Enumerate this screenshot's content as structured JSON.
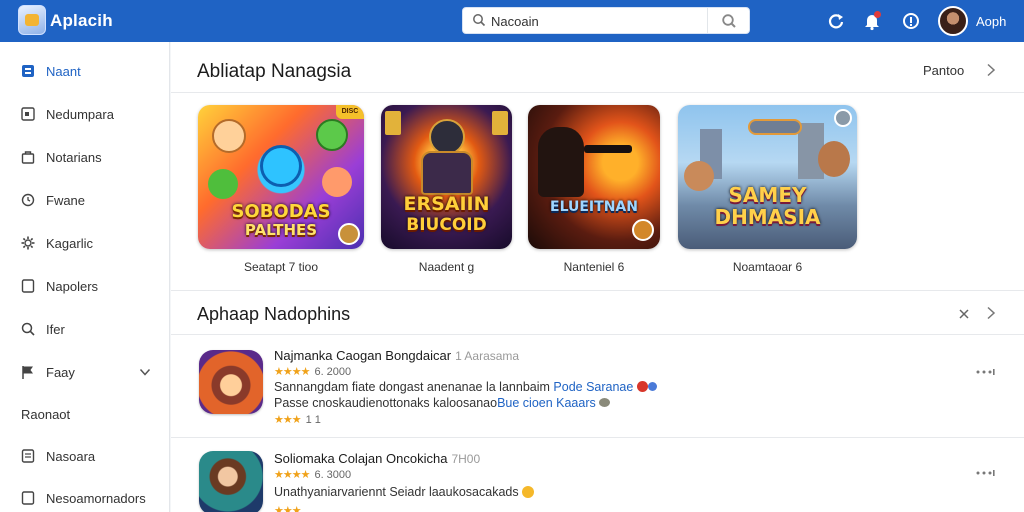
{
  "header": {
    "brand": "Aplacih",
    "search_value": "Nacoain",
    "search_placeholder": "Nacoain",
    "username": "Aoph"
  },
  "sidebar": {
    "items": [
      {
        "label": "Naant",
        "icon": "app-icon",
        "active": true
      },
      {
        "label": "Nedumpara",
        "icon": "square-icon"
      },
      {
        "label": "Notarians",
        "icon": "bag-icon"
      },
      {
        "label": "Fwane",
        "icon": "clock-icon"
      },
      {
        "label": "Kagarlic",
        "icon": "gear-icon"
      },
      {
        "label": "Napolers",
        "icon": "square-icon"
      },
      {
        "label": "Ifer",
        "icon": "search-icon"
      },
      {
        "label": "Faay",
        "icon": "flag-icon",
        "expandable": true
      },
      {
        "label": "Raonaot",
        "icon": ""
      },
      {
        "label": "Nasoara",
        "icon": "square-icon"
      },
      {
        "label": "Nesoamornadors",
        "icon": "square-icon"
      }
    ]
  },
  "featured": {
    "title": "Abliatap Nanagsia",
    "more_label": "Pantoo",
    "cards": [
      {
        "art_title_1": "SOBODAS",
        "art_title_2": "PALTHES",
        "label": "Seatapt 7 tioo",
        "badge": "DISC"
      },
      {
        "art_title_1": "ERSAIIN",
        "art_title_2": "BIUCOID",
        "label": "Naadent g"
      },
      {
        "art_title_1": "ELUEITNAN",
        "art_title_2": "",
        "label": "Nanteniel 6"
      },
      {
        "art_title_1": "SAMEY",
        "art_title_2": "DHMASIA",
        "label": "Noamtaoar 6"
      }
    ]
  },
  "list": {
    "title": "Aphaap Nadophins",
    "apps": [
      {
        "title": "Najmanka Caogan Bongdaicar",
        "subtitle": "1 Aarasama",
        "rating": "6. 2000",
        "desc_1": "Sannangdam fiate dongast anenanae la lannbaim",
        "desc_1_link": "Pode Saranae",
        "desc_2": "Passe cnoskaudienottonaks kaloosanao",
        "desc_2_link": "Bue cioen Kaaars",
        "rating_2": "1 1",
        "stars_1": "★★★★",
        "stars_2": "★★★"
      },
      {
        "title": "Soliomaka Colajan Oncokicha",
        "subtitle": "7H00",
        "rating": "6. 3000",
        "desc_1": "Unathyaniarvariennt Seiadr laaukosacakads",
        "stars_1": "★★★★",
        "stars_2": "★★★"
      }
    ]
  },
  "colors": {
    "topbar": "#1f63c4",
    "accent": "#1f63c4",
    "star": "#f0a21a"
  }
}
